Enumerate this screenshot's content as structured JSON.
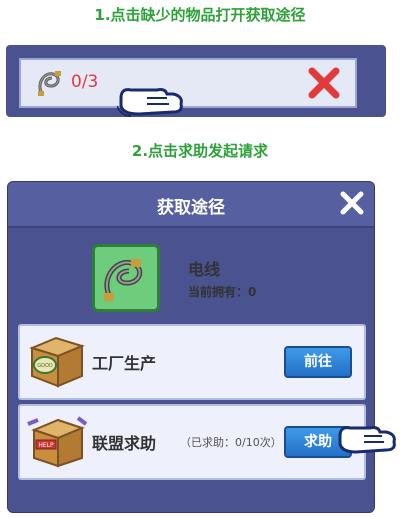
{
  "steps": {
    "step1": "1.点击缺少的物品打开获取途径",
    "step2": "2.点击求助发起请求"
  },
  "strip": {
    "count": "0/3",
    "close_icon": "red-x-icon",
    "accent": "#e23a3a"
  },
  "dialog": {
    "title": "获取途径",
    "item": {
      "name": "电线",
      "owned": "当前拥有：0",
      "icon": "cable-icon"
    },
    "sources": [
      {
        "label": "工厂生产",
        "button": "前往",
        "icon": "good-stuff-box-icon"
      },
      {
        "label": "联盟求助",
        "sub": "（已求助：0/10次）",
        "button": "求助",
        "icon": "help-box-icon"
      }
    ]
  },
  "colors": {
    "panel": "#4a5390",
    "button_blue": "#2f82d8",
    "item_green": "#6ecd7c",
    "step_green": "#2fa13a"
  }
}
